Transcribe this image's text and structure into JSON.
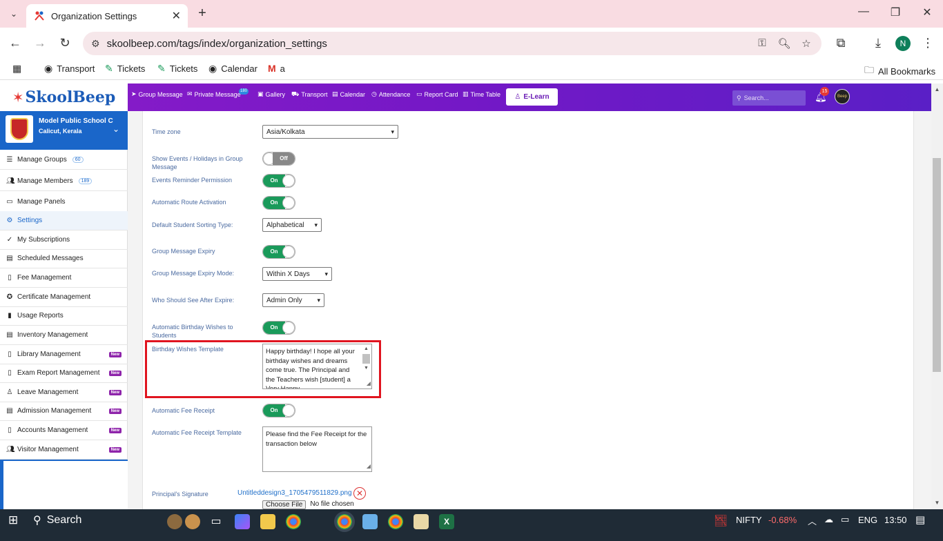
{
  "browser": {
    "tab_title": "Organization Settings",
    "url": "skoolbeep.com/tags/index/organization_settings",
    "profile_initial": "N",
    "bookmarks": [
      "Transport",
      "Tickets",
      "Tickets",
      "Calendar",
      "a"
    ],
    "all_bookmarks": "All Bookmarks"
  },
  "app": {
    "logo": "SkoolBeep",
    "nav": {
      "group_message": "Group Message",
      "private_message": "Private Message",
      "private_badge": "180",
      "gallery": "Gallery",
      "transport": "Transport",
      "calendar": "Calendar",
      "attendance": "Attendance",
      "report_card": "Report Card",
      "time_table": "Time Table",
      "elearn": "E-Learn"
    },
    "search_placeholder": "Search...",
    "notifications": "15",
    "avatar_text": "Beep"
  },
  "sidebar": {
    "school_name": "Model Public School C",
    "school_city": "Calicut, Kerala",
    "items": [
      {
        "label": "Manage Groups",
        "icon": "list-icon",
        "count": "60"
      },
      {
        "label": "Manage Members",
        "icon": "users-icon",
        "count": "189"
      },
      {
        "label": "Manage Panels",
        "icon": "monitor-icon"
      },
      {
        "label": "Settings",
        "icon": "gear-icon"
      },
      {
        "label": "My Subscriptions",
        "icon": "check-icon"
      },
      {
        "label": "Scheduled Messages",
        "icon": "calendar-icon"
      },
      {
        "label": "Fee Management",
        "icon": "document-icon"
      },
      {
        "label": "Certificate Management",
        "icon": "certificate-icon"
      },
      {
        "label": "Usage Reports",
        "icon": "bar-chart-icon"
      },
      {
        "label": "Inventory Management",
        "icon": "inventory-icon"
      },
      {
        "label": "Library Management",
        "icon": "book-icon",
        "badge": "New"
      },
      {
        "label": "Exam Report Management",
        "icon": "report-icon",
        "badge": "New"
      },
      {
        "label": "Leave Management",
        "icon": "leave-icon",
        "badge": "New"
      },
      {
        "label": "Admission Management",
        "icon": "admission-icon",
        "badge": "New"
      },
      {
        "label": "Accounts Management",
        "icon": "accounts-icon",
        "badge": "New"
      },
      {
        "label": "Visitor Management",
        "icon": "visitor-icon",
        "badge": "New"
      }
    ]
  },
  "settings": {
    "timezone": {
      "label": "Time zone",
      "value": "Asia/Kolkata"
    },
    "show_events": {
      "label": "Show Events / Holidays in Group Message",
      "state": "Off"
    },
    "events_reminder": {
      "label": "Events Reminder Permission",
      "state": "On"
    },
    "auto_route": {
      "label": "Automatic Route Activation",
      "state": "On"
    },
    "sorting": {
      "label": "Default Student Sorting Type:",
      "value": "Alphabetical"
    },
    "gm_expiry": {
      "label": "Group Message Expiry",
      "state": "On"
    },
    "gm_expiry_mode": {
      "label": "Group Message Expiry Mode:",
      "value": "Within X Days"
    },
    "who_see": {
      "label": "Who Should See After Expire:",
      "value": "Admin Only"
    },
    "auto_birthday": {
      "label": "Automatic Birthday Wishes to Students",
      "state": "On"
    },
    "birthday_template": {
      "label": "Birthday Wishes Template",
      "value": "Happy birthday! I hope all your birthday wishes and dreams come true. The Principal and the Teachers wish [student] a Very Happy"
    },
    "auto_fee_receipt": {
      "label": "Automatic Fee Receipt",
      "state": "On"
    },
    "fee_template": {
      "label": "Automatic Fee Receipt Template",
      "value": "Please find the Fee Receipt for the transaction below"
    },
    "signature": {
      "label": "Principal's Signature",
      "file": "Untitleddesign3_1705479511829.png",
      "choose": "Choose File",
      "no_file": "No file chosen"
    }
  },
  "taskbar": {
    "search": "Search",
    "nifty": "NIFTY",
    "nifty_change": "-0.68%",
    "lang": "ENG",
    "time": "13:50"
  }
}
